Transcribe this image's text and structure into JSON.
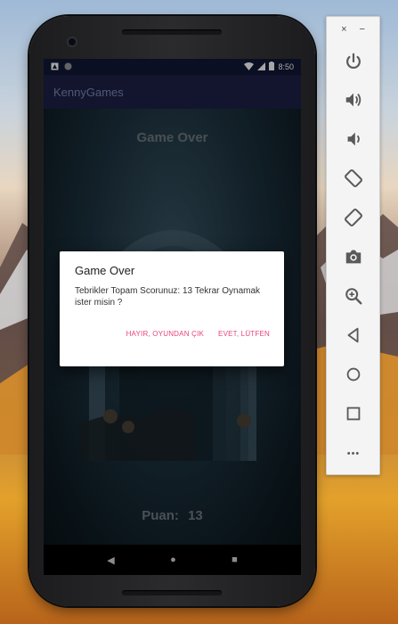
{
  "status_bar": {
    "time": "8:50"
  },
  "app_bar": {
    "title": "KennyGames"
  },
  "game": {
    "title": "Game Over",
    "score_label": "Puan:",
    "score_value": "13"
  },
  "dialog": {
    "title": "Game Over",
    "message": "Tebrikler Topam Scorunuz: 13 Tekrar Oynamak ister misin ?",
    "negative_label": "HAYIR, OYUNDAN ÇIK",
    "positive_label": "EVET, LÜTFEN",
    "accent_color": "#e8457b"
  },
  "navigation": {
    "back": "◀",
    "home": "●",
    "recents": "■"
  },
  "emulator_panel": {
    "close": "×",
    "minimize": "−",
    "more": "•••",
    "tools": [
      "power-icon",
      "volume-up-icon",
      "volume-down-icon",
      "rotate-left-icon",
      "rotate-right-icon",
      "camera-icon",
      "zoom-icon",
      "back-icon",
      "home-icon",
      "overview-icon"
    ]
  }
}
